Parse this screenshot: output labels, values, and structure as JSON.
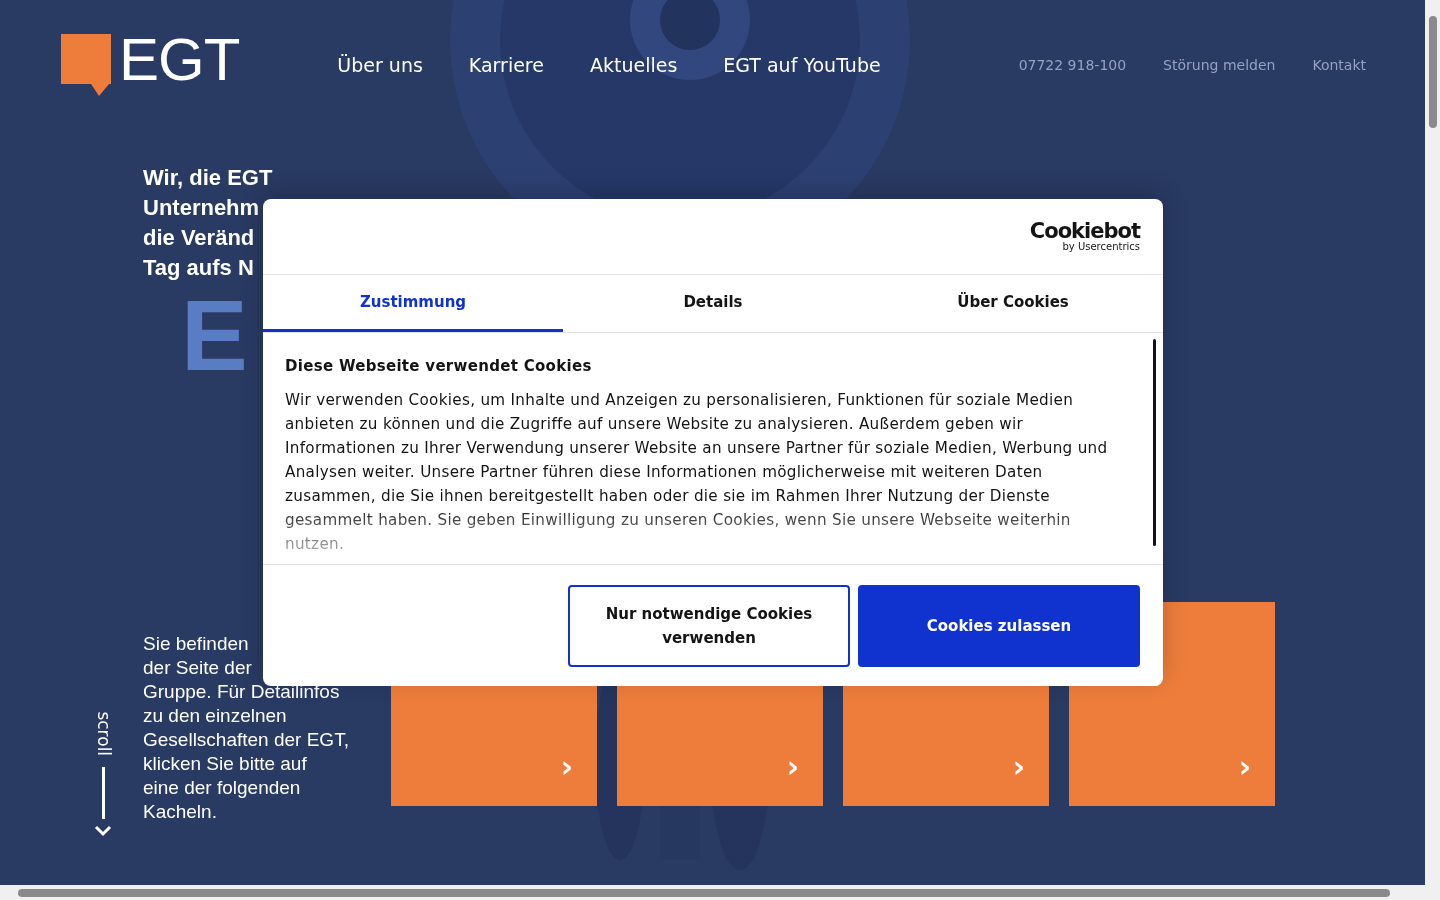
{
  "header": {
    "logo": "EGT",
    "nav": [
      "Über uns",
      "Karriere",
      "Aktuelles",
      "EGT auf YouTube"
    ],
    "links": [
      "07722 918-100",
      "Störung melden",
      "Kontakt"
    ]
  },
  "hero": {
    "headline_lines": [
      "Wir, die EGT",
      "Unternehm",
      "die Veränd",
      "Tag aufs N"
    ],
    "big_text": "E"
  },
  "intro": {
    "lines": [
      "Sie befinden",
      "der Seite der",
      "Gruppe. Für Detailinfos",
      "zu den einzelnen",
      "Gesellschaften der EGT,",
      "klicken Sie bitte auf",
      "eine der folgenden",
      "Kacheln."
    ],
    "scroll_label": "scroll"
  },
  "tiles": [
    {
      "arrow": "›"
    },
    {
      "arrow": "›"
    },
    {
      "arrow": "›"
    },
    {
      "arrow": "›"
    }
  ],
  "cookie_dialog": {
    "brand": "Cookiebot",
    "brand_sub": "by Usercentrics",
    "tabs": [
      {
        "label": "Zustimmung",
        "selected": true
      },
      {
        "label": "Details",
        "selected": false
      },
      {
        "label": "Über Cookies",
        "selected": false
      }
    ],
    "title": "Diese Webseite verwendet Cookies",
    "body": "Wir verwenden Cookies, um Inhalte und Anzeigen zu personalisieren, Funktionen für soziale Medien anbieten zu können und die Zugriffe auf unsere Website zu analysieren. Außerdem geben wir Informationen zu Ihrer Verwendung unserer Website an unsere Partner für soziale Medien, Werbung und Analysen weiter. Unsere Partner führen diese Informationen möglicherweise mit weiteren Daten zusammen, die Sie ihnen bereitgestellt haben oder die sie im Rahmen Ihrer Nutzung der Dienste gesammelt haben. Sie geben Einwilligung zu unseren Cookies, wenn Sie unsere Webseite weiterhin nutzen.",
    "buttons": [
      {
        "label": "Nur notwendige Cookies verwenden",
        "kind": "outline"
      },
      {
        "label": "Cookies zulassen",
        "kind": "primary"
      }
    ]
  }
}
